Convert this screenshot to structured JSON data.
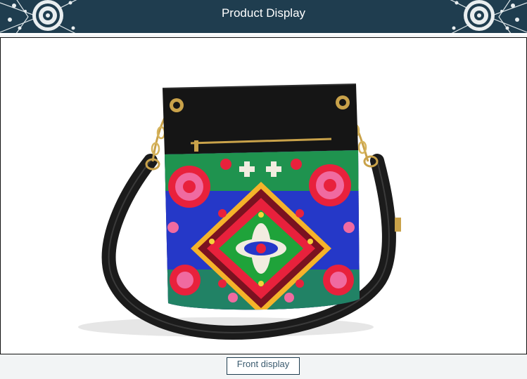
{
  "header": {
    "title": "Product Display"
  },
  "product": {
    "caption": "Front display"
  },
  "colors": {
    "header_bg": "#1f3d4f",
    "accent": "#3a5a6e",
    "bag_body": "#151515",
    "pattern_red": "#e8213c",
    "pattern_blue": "#2538c8",
    "pattern_green": "#1fa33a",
    "pattern_pink": "#f06aa0"
  }
}
